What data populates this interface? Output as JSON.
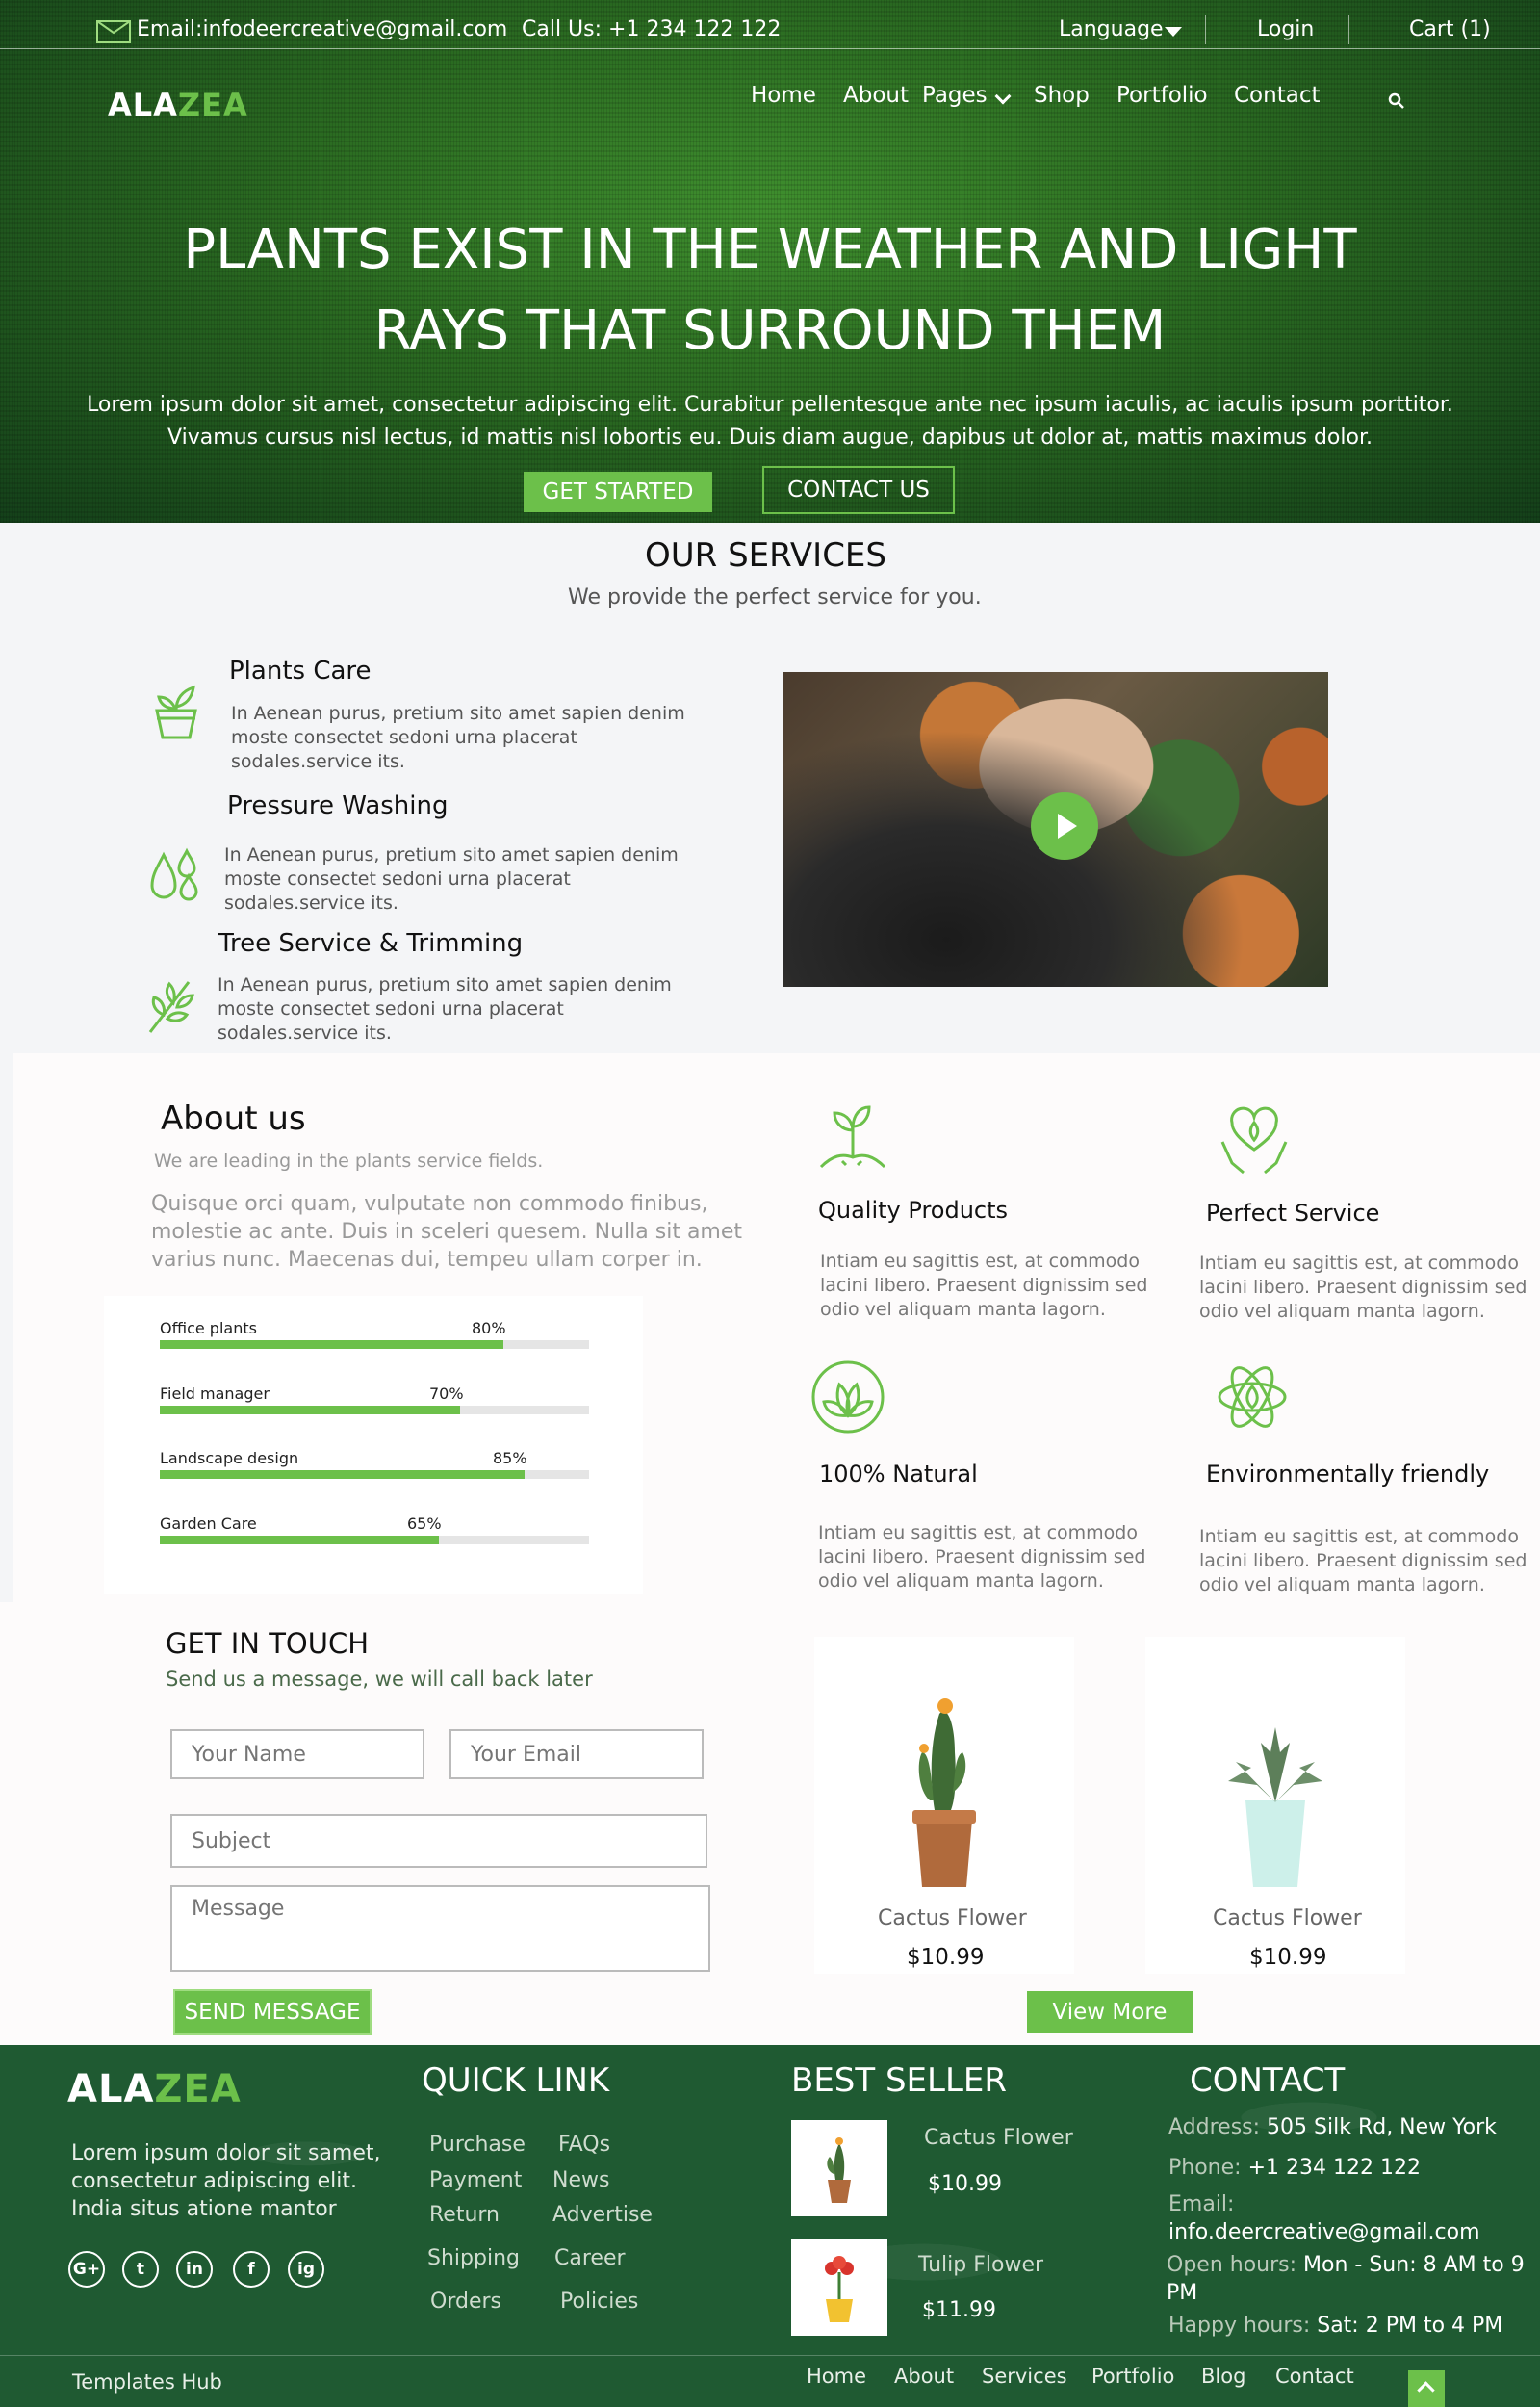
{
  "topbar": {
    "email": "Email:infodeercreative@gmail.com",
    "phone": "Call Us: +1 234 122 122",
    "language": "Language",
    "login": "Login",
    "cart": "Cart (1)"
  },
  "brand": {
    "part1": "ALA",
    "part2": "ZEA"
  },
  "nav": {
    "items": [
      "Home",
      "About",
      "Pages",
      "Shop",
      "Portfolio",
      "Contact"
    ]
  },
  "hero": {
    "title_line1": "PLANTS EXIST IN THE WEATHER AND LIGHT",
    "title_line2": "RAYS THAT SURROUND THEM",
    "text": "Lorem ipsum dolor sit amet, consectetur adipiscing elit. Curabitur pellentesque ante nec ipsum iaculis, ac iaculis ipsum porttitor. Vivamus cursus nisl lectus, id mattis nisl lobortis eu. Duis diam augue, dapibus ut dolor at, mattis maximus dolor.",
    "cta_primary": "GET STARTED",
    "cta_secondary": "CONTACT US"
  },
  "services": {
    "title": "OUR SERVICES",
    "subtitle": "We provide the perfect service for you.",
    "items": [
      {
        "title": "Plants Care",
        "text": "In Aenean purus, pretium sito amet sapien denim moste consectet sedoni urna placerat sodales.service its.",
        "icon": "plant-pot-icon"
      },
      {
        "title": "Pressure Washing",
        "text": "In Aenean purus, pretium sito amet sapien denim moste consectet sedoni urna placerat sodales.service its.",
        "icon": "water-drops-icon"
      },
      {
        "title": "Tree Service & Trimming",
        "text": "In Aenean purus, pretium sito amet sapien denim moste consectet sedoni urna placerat sodales.service its.",
        "icon": "leaf-branch-icon"
      }
    ]
  },
  "about": {
    "title": "About us",
    "lead": "We are leading in the plants service fields.",
    "text": "Quisque orci quam, vulputate non commodo finibus, molestie ac ante. Duis in sceleri quesem. Nulla sit amet varius nunc. Maecenas dui, tempeu ullam corper in.",
    "skills": [
      {
        "label": "Office plants",
        "pct": "80%",
        "value": 0.8
      },
      {
        "label": "Field manager",
        "pct": "70%",
        "value": 0.7
      },
      {
        "label": "Landscape design",
        "pct": "85%",
        "value": 0.85
      },
      {
        "label": "Garden Care",
        "pct": "65%",
        "value": 0.65
      }
    ],
    "features": [
      {
        "title": "Quality Products",
        "text": "Intiam eu sagittis est, at commodo lacini libero. Praesent dignissim sed odio vel aliquam manta lagorn.",
        "icon": "sprout-icon"
      },
      {
        "title": "Perfect Service",
        "text": "Intiam eu sagittis est, at commodo lacini libero. Praesent dignissim sed odio vel aliquam manta lagorn.",
        "icon": "hands-heart-leaf-icon"
      },
      {
        "title": "100% Natural",
        "text": "Intiam eu sagittis est, at commodo lacini libero. Praesent dignissim sed odio vel aliquam manta lagorn.",
        "icon": "natural-leaves-icon"
      },
      {
        "title": "Environmentally friendly",
        "text": "Intiam eu sagittis est, at commodo lacini libero. Praesent dignissim sed odio vel aliquam manta lagorn.",
        "icon": "eco-atom-icon"
      }
    ]
  },
  "contact_form": {
    "title": "GET IN TOUCH",
    "subtitle": "Send us a message, we will call back later",
    "name_placeholder": "Your Name",
    "email_placeholder": "Your Email",
    "subject_placeholder": "Subject",
    "message_placeholder": "Message",
    "submit": "SEND MESSAGE"
  },
  "products": {
    "items": [
      {
        "name": "Cactus Flower",
        "price": "$10.99"
      },
      {
        "name": "Cactus Flower",
        "price": "$10.99"
      }
    ],
    "view_more": "View More"
  },
  "footer": {
    "about_text": "Lorem ipsum dolor sit samet, consectetur adipiscing elit. India situs atione mantor",
    "social": [
      "G+",
      "t",
      "in",
      "f",
      "ig"
    ],
    "quick_link_title": "QUICK LINK",
    "quick_links_col1": [
      "Purchase",
      "Payment",
      "Return",
      "Shipping",
      "Orders"
    ],
    "quick_links_col2": [
      "FAQs",
      "News",
      "Advertise",
      "Career",
      "Policies"
    ],
    "best_seller_title": "BEST SELLER",
    "best_sellers": [
      {
        "name": "Cactus Flower",
        "price": "$10.99"
      },
      {
        "name": "Tulip Flower",
        "price": "$11.99"
      }
    ],
    "contact_title": "CONTACT",
    "address_label": "Address:",
    "address": "505 Silk Rd, New York",
    "phone_label": "Phone:",
    "phone": "+1 234 122 122",
    "email_label": "Email:",
    "email": "info.deercreative@gmail.com",
    "open_label": "Open hours:",
    "open_hours_line1": "Mon - Sun: 8 AM to 9",
    "open_hours_line2": "PM",
    "happy_label": "Happy hours:",
    "happy_hours": "Sat: 2 PM to 4 PM",
    "credit": "Templates Hub",
    "bottom_links": [
      "Home",
      "About",
      "Services",
      "Portfolio",
      "Blog",
      "Contact"
    ]
  },
  "colors": {
    "accent": "#6cc04a",
    "footer_bg": "#1f5a32",
    "hero_bg": "#2a6a21"
  }
}
